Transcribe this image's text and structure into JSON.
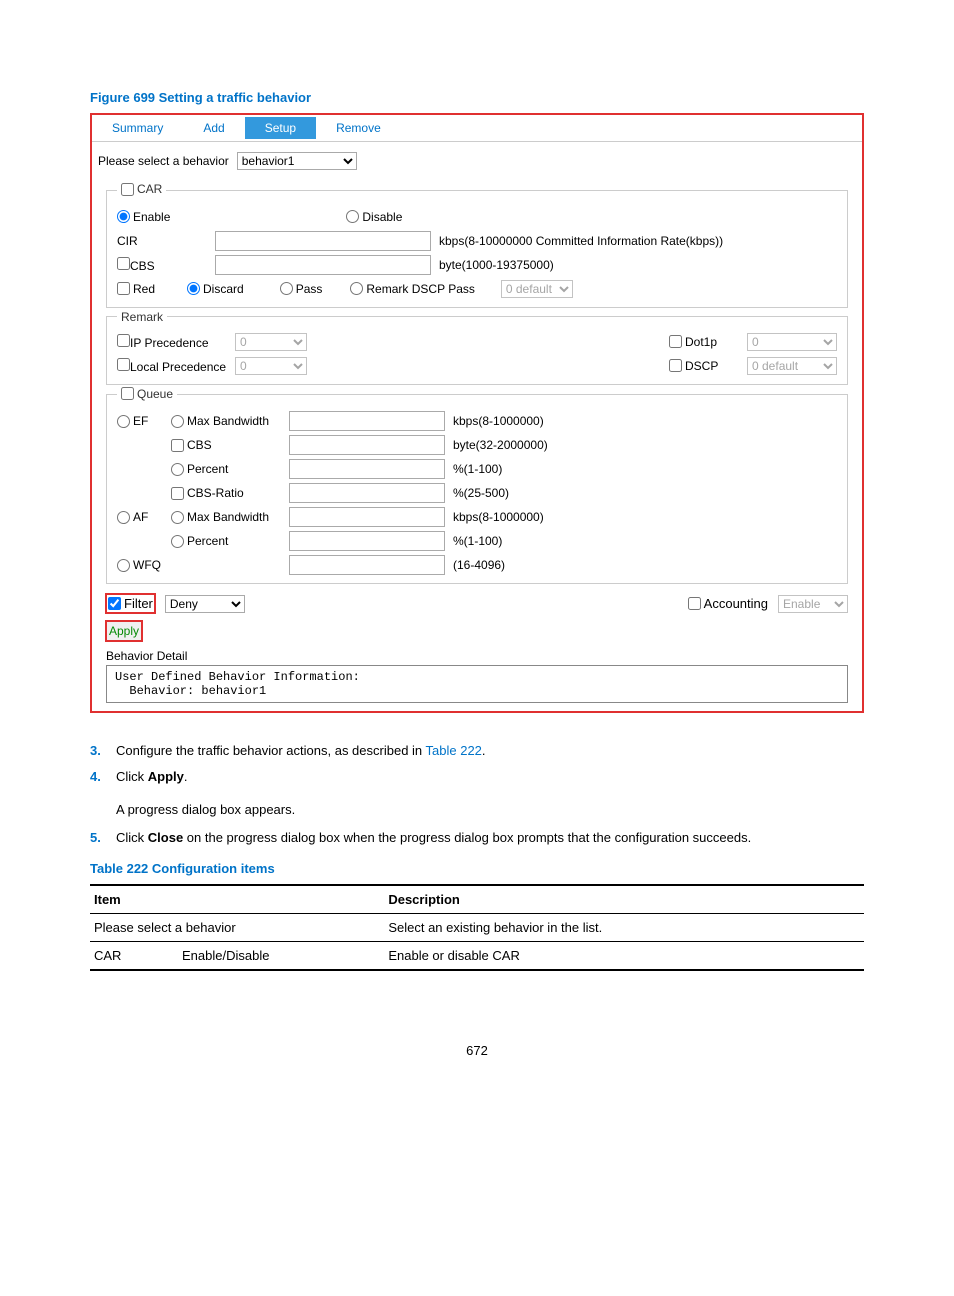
{
  "figure_caption": "Figure 699 Setting a traffic behavior",
  "tabs": {
    "summary": "Summary",
    "add": "Add",
    "setup": "Setup",
    "remove": "Remove"
  },
  "top": {
    "label": "Please select a behavior",
    "value": "behavior1"
  },
  "car": {
    "legend": "CAR",
    "enable": "Enable",
    "disable": "Disable",
    "cir": "CIR",
    "cir_hint": "kbps(8-10000000 Committed Information Rate(kbps))",
    "cbs": "CBS",
    "cbs_hint": "byte(1000-19375000)",
    "red": "Red",
    "discard": "Discard",
    "pass": "Pass",
    "remark": "Remark DSCP Pass",
    "remark_val": "0 default"
  },
  "remark": {
    "legend": "Remark",
    "ipp": "IP Precedence",
    "ipp_val": "0",
    "locp": "Local Precedence",
    "locp_val": "0",
    "dot1p": "Dot1p",
    "dot1p_val": "0",
    "dscp": "DSCP",
    "dscp_val": "0 default"
  },
  "queue": {
    "legend": "Queue",
    "ef": "EF",
    "maxbw": "Max Bandwidth",
    "maxbw_hint": "kbps(8-1000000)",
    "cbs": "CBS",
    "cbs_hint": "byte(32-2000000)",
    "percent": "Percent",
    "percent_hint": "%(1-100)",
    "cbsratio": "CBS-Ratio",
    "cbsratio_hint": "%(25-500)",
    "af": "AF",
    "af_maxbw_hint": "kbps(8-1000000)",
    "af_percent_hint": "%(1-100)",
    "wfq": "WFQ",
    "wfq_hint": "(16-4096)"
  },
  "bottom": {
    "filter": "Filter",
    "filter_val": "Deny",
    "accounting": "Accounting",
    "accounting_val": "Enable",
    "apply": "Apply",
    "behav_detail_label": "Behavior Detail",
    "behav_detail": "User Defined Behavior Information:\n  Behavior: behavior1"
  },
  "steps": {
    "s3_a": "Configure the traffic behavior actions, as described in ",
    "s3_link": "Table 222",
    "s3_b": ".",
    "s4_a": "Click ",
    "s4_b": "Apply",
    "s4_c": ".",
    "s4_sub": "A progress dialog box appears.",
    "s5_a": "Click ",
    "s5_b": "Close",
    "s5_c": " on the progress dialog box when the progress dialog box prompts that the configuration succeeds."
  },
  "table_caption": "Table 222 Configuration items",
  "table": {
    "h1": "Item",
    "h2": "Description",
    "r1c1": "Please select a behavior",
    "r1c2": "Select an existing behavior in the list.",
    "r2c1a": "CAR",
    "r2c1b": "Enable/Disable",
    "r2c2": "Enable or disable CAR"
  },
  "page_number": "672"
}
